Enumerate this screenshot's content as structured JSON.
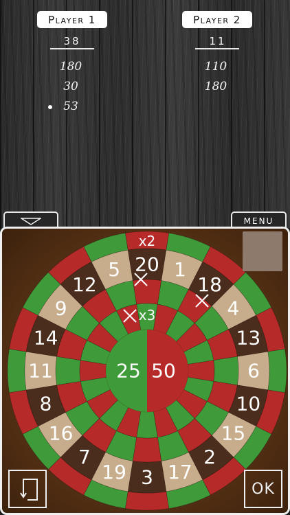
{
  "players": [
    {
      "name": "Player 1",
      "score": "38",
      "history": [
        "180",
        "30",
        "53"
      ]
    },
    {
      "name": "Player 2",
      "score": "11",
      "history": [
        "110",
        "180"
      ]
    }
  ],
  "controls": {
    "menu_label": "MENU",
    "ok_label": "OK"
  },
  "board": {
    "numbers": [
      20,
      1,
      18,
      4,
      13,
      6,
      10,
      15,
      2,
      17,
      3,
      19,
      7,
      16,
      8,
      11,
      14,
      9,
      12,
      5
    ],
    "outer_bull_label": "25",
    "bull_label": "50",
    "double_label": "x2",
    "triple_label": "x3",
    "colors": {
      "red": "#b72a2a",
      "green": "#3f9a3a",
      "dark": "#4a2d1c",
      "light": "#c8ad8c",
      "number": "#ffffff"
    }
  }
}
